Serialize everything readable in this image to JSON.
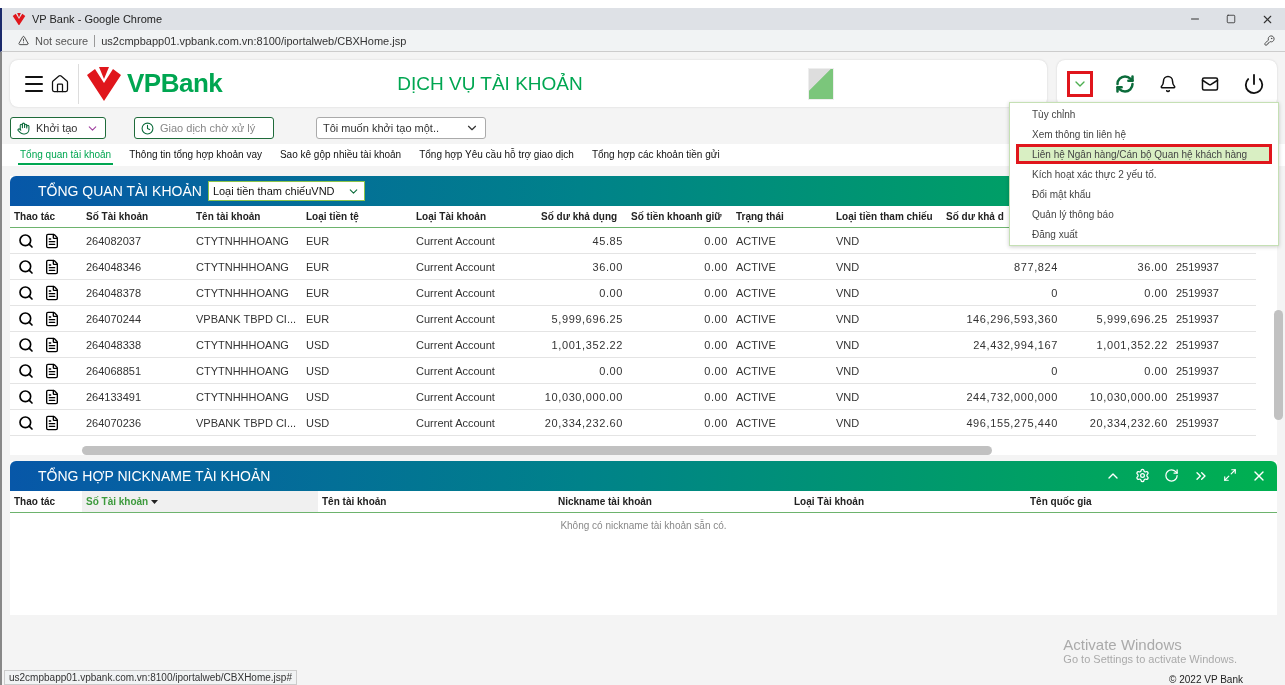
{
  "window": {
    "title": "VP Bank - Google Chrome"
  },
  "address_bar": {
    "security": "Not secure",
    "url": "us2cmpbapp01.vpbank.com.vn:8100/iportalweb/CBXHome.jsp"
  },
  "header": {
    "brand": "VPBank",
    "title": "DỊCH VỤ TÀI KHOẢN",
    "menu_button_marked": true
  },
  "user_menu": [
    {
      "label": "Tùy chỉnh",
      "selected": false
    },
    {
      "label": "Xem thông tin liên hệ",
      "selected": false
    },
    {
      "label": "Liên hệ Ngân hàng/Cán bộ Quan hệ khách hàng",
      "selected": true
    },
    {
      "label": "Kích hoạt xác thực 2 yếu tố.",
      "selected": false
    },
    {
      "label": "Đổi mật khẩu",
      "selected": false
    },
    {
      "label": "Quản lý thông báo",
      "selected": false
    },
    {
      "label": "Đăng xuất",
      "selected": false
    }
  ],
  "toolbar": {
    "create": "Khởi tạo",
    "pending": "Giao dịch chờ xử lý",
    "wish": "Tôi muốn khởi tạo một.."
  },
  "tabs": [
    {
      "label": "Tổng quan tài khoản",
      "selected": true
    },
    {
      "label": "Thông tin tổng hợp khoản vay",
      "selected": false
    },
    {
      "label": "Sao kê gộp nhiều tài khoản",
      "selected": false
    },
    {
      "label": "Tổng hợp Yêu cầu hỗ trợ giao dịch",
      "selected": false
    },
    {
      "label": "Tổng hợp các khoản tiền gửi",
      "selected": false
    }
  ],
  "overview": {
    "title": "TỔNG QUAN TÀI KHOẢN",
    "currency_select": "Loại tiền tham chiếuVND",
    "columns": [
      "Thao tác",
      "Số Tài khoản",
      "Tên tài khoản",
      "Loại tiền tệ",
      "Loại Tài khoản",
      "Số dư khả dụng",
      "Số tiền khoanh giữ",
      "Trạng thái",
      "Loại tiền tham chiếu",
      "Số dư khả d"
    ],
    "rows": [
      [
        "",
        "264082037",
        "CTYTNHHHOANG",
        "EUR",
        "Current Account",
        "45.85",
        "0.00",
        "ACTIVE",
        "VND"
      ],
      [
        "",
        "264048346",
        "CTYTNHHHOANG",
        "EUR",
        "Current Account",
        "36.00",
        "0.00",
        "ACTIVE",
        "VND",
        "877,824",
        "36.00",
        "2519937"
      ],
      [
        "",
        "264048378",
        "CTYTNHHHOANG",
        "EUR",
        "Current Account",
        "0.00",
        "0.00",
        "ACTIVE",
        "VND",
        "0",
        "0.00",
        "2519937"
      ],
      [
        "",
        "264070244",
        "VPBANK TBPD CI...",
        "EUR",
        "Current Account",
        "5,999,696.25",
        "0.00",
        "ACTIVE",
        "VND",
        "146,296,593,360",
        "5,999,696.25",
        "2519937"
      ],
      [
        "",
        "264048338",
        "CTYTNHHHOANG",
        "USD",
        "Current Account",
        "1,001,352.22",
        "0.00",
        "ACTIVE",
        "VND",
        "24,432,994,167",
        "1,001,352.22",
        "2519937"
      ],
      [
        "",
        "264068851",
        "CTYTNHHHOANG",
        "USD",
        "Current Account",
        "0.00",
        "0.00",
        "ACTIVE",
        "VND",
        "0",
        "0.00",
        "2519937"
      ],
      [
        "",
        "264133491",
        "CTYTNHHHOANG",
        "USD",
        "Current Account",
        "10,030,000.00",
        "0.00",
        "ACTIVE",
        "VND",
        "244,732,000,000",
        "10,030,000.00",
        "2519937"
      ],
      [
        "",
        "264070236",
        "VPBANK TBPD CI...",
        "USD",
        "Current Account",
        "20,334,232.60",
        "0.00",
        "ACTIVE",
        "VND",
        "496,155,275,440",
        "20,334,232.60",
        "2519937"
      ]
    ]
  },
  "nickname": {
    "title": "TỔNG HỢP NICKNAME TÀI KHOẢN",
    "columns": [
      {
        "label": "Thao tác",
        "sorted": false
      },
      {
        "label": "Số Tài khoản",
        "sorted": true
      },
      {
        "label": "Tên tài khoản",
        "sorted": false
      },
      {
        "label": "Nickname tài khoản",
        "sorted": false
      },
      {
        "label": "Loại Tài khoản",
        "sorted": false
      },
      {
        "label": "Tên quốc gia",
        "sorted": false
      }
    ],
    "empty_message": "Không có nickname tài khoản sẵn có."
  },
  "status_url": "us2cmpbapp01.vpbank.com.vn:8100/iportalweb/CBXHome.jsp#",
  "footer": "© 2022 VP Bank",
  "activation": {
    "title": "Activate Windows",
    "hint": "Go to Settings to activate Windows."
  }
}
